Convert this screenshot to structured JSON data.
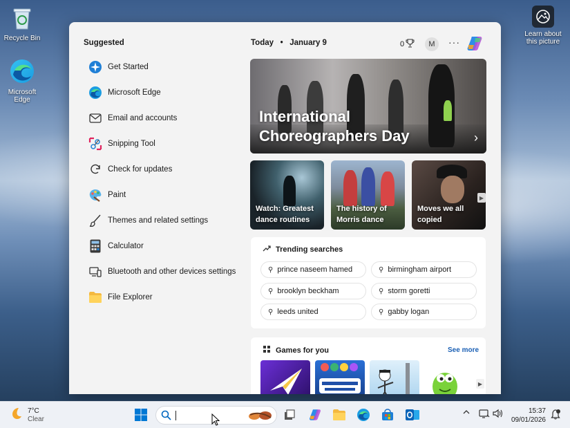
{
  "desktop": {
    "recycle_bin": "Recycle Bin",
    "edge": "Microsoft Edge",
    "learn_about": "Learn about this picture"
  },
  "start": {
    "suggested_title": "Suggested",
    "suggested": [
      {
        "label": "Get Started",
        "icon": "get-started-icon"
      },
      {
        "label": "Microsoft Edge",
        "icon": "edge-icon"
      },
      {
        "label": "Email and accounts",
        "icon": "mail-icon"
      },
      {
        "label": "Snipping Tool",
        "icon": "snipping-tool-icon"
      },
      {
        "label": "Check for updates",
        "icon": "refresh-icon"
      },
      {
        "label": "Paint",
        "icon": "paint-icon"
      },
      {
        "label": "Themes and related settings",
        "icon": "brush-icon"
      },
      {
        "label": "Calculator",
        "icon": "calculator-icon"
      },
      {
        "label": "Bluetooth and other devices settings",
        "icon": "devices-icon"
      },
      {
        "label": "File Explorer",
        "icon": "folder-icon"
      }
    ]
  },
  "widgets": {
    "today": "Today",
    "date": "January 9",
    "points": "0",
    "avatar_initial": "M",
    "hero_title": "International Choreographers Day",
    "tiles": [
      {
        "title": "Watch: Greatest dance routines"
      },
      {
        "title": "The history of Morris dance"
      },
      {
        "title": "Moves we all copied"
      }
    ],
    "trending_title": "Trending searches",
    "trending": [
      "prince naseem hamed",
      "birmingham airport",
      "brooklyn beckham",
      "storm goretti",
      "leeds united",
      "gabby logan"
    ],
    "games_title": "Games for you",
    "see_more": "See more"
  },
  "taskbar": {
    "temperature": "7°C",
    "condition": "Clear",
    "time": "15:37",
    "date": "09/01/2026"
  },
  "colors": {
    "accent": "#0067c0",
    "link": "#1a5fb4",
    "panel_bg": "#f3f3f3",
    "taskbar_bg": "#eef1f6"
  }
}
